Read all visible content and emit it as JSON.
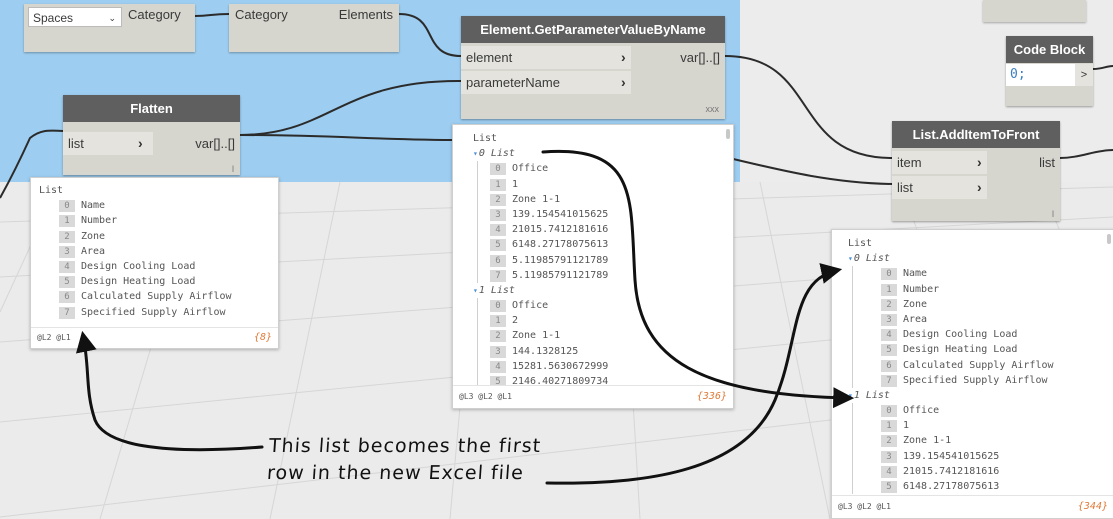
{
  "nodes": {
    "spaces": {
      "dropdown_value": "Spaces",
      "output": "Category"
    },
    "category": {
      "input": "Category",
      "output": "Elements"
    },
    "get_param": {
      "title": "Element.GetParameterValueByName",
      "inputs": [
        "element",
        "parameterName"
      ],
      "output": "var[]..[]",
      "footer": "xxx"
    },
    "code_block": {
      "title": "Code Block",
      "code": "0;",
      "output": ">"
    },
    "flatten": {
      "title": "Flatten",
      "input": "list",
      "output": "var[]..[]",
      "footer": "l"
    },
    "add_item": {
      "title": "List.AddItemToFront",
      "inputs": [
        "item",
        "list"
      ],
      "output": "list",
      "footer": "l"
    }
  },
  "previews": {
    "flatten": {
      "root": "List",
      "items": [
        "Name",
        "Number",
        "Zone",
        "Area",
        "Design Cooling Load",
        "Design Heating Load",
        "Calculated Supply Airflow",
        "Specified Supply Airflow"
      ],
      "levels": "@L2 @L1",
      "count": "{8}"
    },
    "get_param": {
      "root": "List",
      "groups": [
        {
          "label": "0 List",
          "items": [
            "Office",
            "1",
            "Zone 1-1",
            "139.154541015625",
            "21015.7412181616",
            "6148.27178075613",
            "5.11985791121789",
            "5.11985791121789"
          ]
        },
        {
          "label": "1 List",
          "items": [
            "Office",
            "2",
            "Zone 1-1",
            "144.1328125",
            "15281.5630672999",
            "2146.40271809734"
          ]
        }
      ],
      "levels": "@L3 @L2 @L1",
      "count": "{336}"
    },
    "add_item": {
      "root": "List",
      "groups": [
        {
          "label": "0 List",
          "items": [
            "Name",
            "Number",
            "Zone",
            "Area",
            "Design Cooling Load",
            "Design Heating Load",
            "Calculated Supply Airflow",
            "Specified Supply Airflow"
          ]
        },
        {
          "label": "1 List",
          "items": [
            "Office",
            "1",
            "Zone 1-1",
            "139.154541015625",
            "21015.7412181616",
            "6148.27178075613"
          ]
        }
      ],
      "levels": "@L3 @L2 @L1",
      "count": "{344}"
    }
  },
  "annotation": {
    "line1": "This list becomes the first",
    "line2": "row in the new Excel file"
  },
  "colors": {
    "background": "#9dcdf0",
    "node_header": "#5f5f5f",
    "node_body": "#d6d5ce",
    "count_text": "#e07b3a",
    "index_caret": "#4a90d9"
  }
}
